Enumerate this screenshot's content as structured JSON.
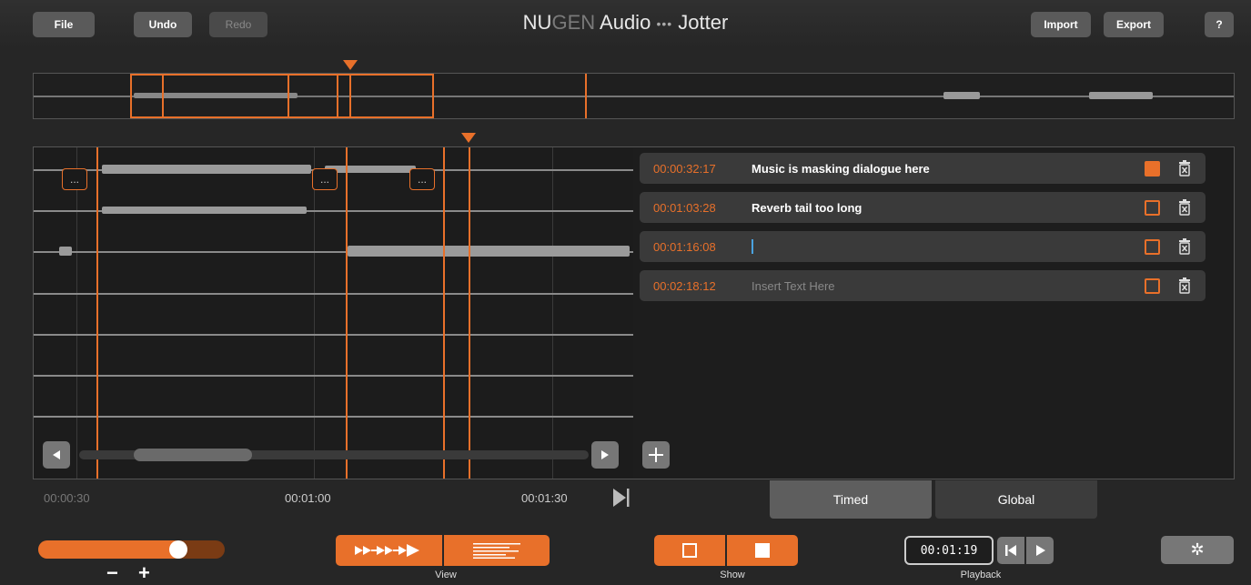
{
  "header": {
    "file_label": "File",
    "undo_label": "Undo",
    "redo_label": "Redo",
    "title_brand_a": "NU",
    "title_brand_b": "GEN",
    "title_brand_c": " Audio",
    "title_separator": "•••",
    "title_app": "Jotter",
    "import_label": "Import",
    "export_label": "Export",
    "help_label": "?"
  },
  "markers": {
    "label": "..."
  },
  "notes": [
    {
      "time": "00:00:32:17",
      "text": "Music is masking dialogue here",
      "checked": true
    },
    {
      "time": "00:01:03:28",
      "text": "Reverb tail too long",
      "checked": false
    },
    {
      "time": "00:01:16:08",
      "text": "",
      "checked": false,
      "editing": true
    },
    {
      "time": "00:02:18:12",
      "text": "Insert Text Here",
      "checked": false,
      "placeholder": true
    }
  ],
  "timeline": {
    "labels": [
      "00:00:30",
      "00:01:00",
      "00:01:30"
    ]
  },
  "tabs": {
    "timed": "Timed",
    "global": "Global"
  },
  "footer": {
    "zoom_minus": "−",
    "zoom_plus": "+",
    "zoom_level": 0.78,
    "view_label": "View",
    "show_label": "Show",
    "playback_label": "Playback",
    "playback_time": "00:01:19"
  },
  "colors": {
    "accent": "#e8702a",
    "background": "#262626",
    "panel": "#1d1d1d",
    "button": "#5a5a5a"
  }
}
